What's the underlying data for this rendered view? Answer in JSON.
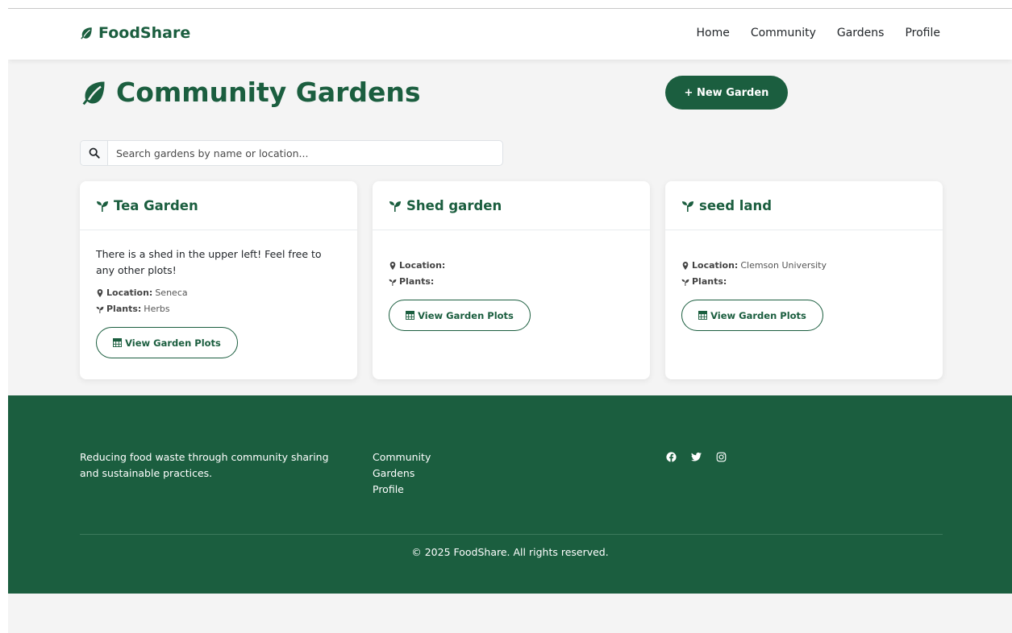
{
  "colors": {
    "brand": "#1b5e3f",
    "background": "#f4f4f4",
    "card": "#ffffff"
  },
  "navbar": {
    "brand": "FoodShare",
    "brand_icon": "leaf-icon",
    "links": [
      "Home",
      "Community",
      "Gardens",
      "Profile"
    ]
  },
  "header": {
    "title": "Community Gardens",
    "title_icon": "leaf-icon",
    "new_button": "+ New Garden"
  },
  "search": {
    "icon": "search-icon",
    "placeholder": "Search gardens by name or location...",
    "value": ""
  },
  "labels": {
    "location": "Location:",
    "plants": "Plants:",
    "view_plots": "View Garden Plots"
  },
  "gardens": [
    {
      "name": "Tea Garden",
      "description": "There is a shed in the upper left! Feel free to any other plots!",
      "location": "Seneca",
      "plants": "Herbs"
    },
    {
      "name": "Shed garden",
      "description": "",
      "location": "",
      "plants": ""
    },
    {
      "name": "seed land",
      "description": "",
      "location": "Clemson University",
      "plants": ""
    }
  ],
  "footer": {
    "tagline": "Reducing food waste through community sharing and sustainable practices.",
    "links": [
      "Community",
      "Gardens",
      "Profile"
    ],
    "social_icons": [
      "facebook-icon",
      "twitter-icon",
      "instagram-icon"
    ],
    "copyright": "© 2025 FoodShare. All rights reserved."
  }
}
